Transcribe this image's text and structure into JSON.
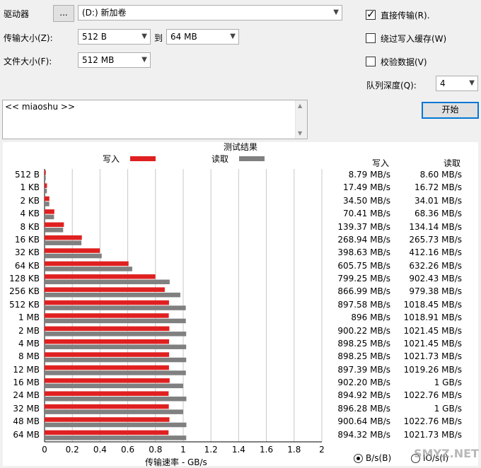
{
  "drive": {
    "label": "驱动器",
    "browse_label": "...",
    "value": "(D:) 新加卷"
  },
  "transfer_size": {
    "label": "传输大小(Z):",
    "from": "512 B",
    "to_label": "到",
    "to": "64 MB"
  },
  "file_size": {
    "label": "文件大小(F):",
    "value": "512 MB"
  },
  "options": {
    "direct_io": {
      "label": "直接传输(R).",
      "checked": true
    },
    "bypass_write_cache": {
      "label": "绕过写入缓存(W)",
      "checked": false
    },
    "verify_data": {
      "label": "校验数据(V)",
      "checked": false
    }
  },
  "queue_depth": {
    "label": "队列深度(Q):",
    "value": "4"
  },
  "description": {
    "value": "<< miaoshu >>"
  },
  "start_button": {
    "label": "开始"
  },
  "results": {
    "title": "测试结果",
    "legend_write": "写入",
    "legend_read": "读取",
    "col_write": "写入",
    "col_read": "读取",
    "xlabel": "传输速率 - GB/s",
    "rows": [
      {
        "size": "512 B",
        "write": "8.79 MB/s",
        "read": "8.60 MB/s"
      },
      {
        "size": "1 KB",
        "write": "17.49 MB/s",
        "read": "16.72 MB/s"
      },
      {
        "size": "2 KB",
        "write": "34.50 MB/s",
        "read": "34.01 MB/s"
      },
      {
        "size": "4 KB",
        "write": "70.41 MB/s",
        "read": "68.36 MB/s"
      },
      {
        "size": "8 KB",
        "write": "139.37 MB/s",
        "read": "134.14 MB/s"
      },
      {
        "size": "16 KB",
        "write": "268.94 MB/s",
        "read": "265.73 MB/s"
      },
      {
        "size": "32 KB",
        "write": "398.63 MB/s",
        "read": "412.16 MB/s"
      },
      {
        "size": "64 KB",
        "write": "605.75 MB/s",
        "read": "632.26 MB/s"
      },
      {
        "size": "128 KB",
        "write": "799.25 MB/s",
        "read": "902.43 MB/s"
      },
      {
        "size": "256 KB",
        "write": "866.99 MB/s",
        "read": "979.38 MB/s"
      },
      {
        "size": "512 KB",
        "write": "897.58 MB/s",
        "read": "1018.45 MB/s"
      },
      {
        "size": "1 MB",
        "write": "896 MB/s",
        "read": "1018.91 MB/s"
      },
      {
        "size": "2 MB",
        "write": "900.22 MB/s",
        "read": "1021.45 MB/s"
      },
      {
        "size": "4 MB",
        "write": "898.25 MB/s",
        "read": "1021.45 MB/s"
      },
      {
        "size": "8 MB",
        "write": "898.25 MB/s",
        "read": "1021.73 MB/s"
      },
      {
        "size": "12 MB",
        "write": "897.39 MB/s",
        "read": "1019.26 MB/s"
      },
      {
        "size": "16 MB",
        "write": "902.20 MB/s",
        "read": "1 GB/s"
      },
      {
        "size": "24 MB",
        "write": "894.92 MB/s",
        "read": "1022.76 MB/s"
      },
      {
        "size": "32 MB",
        "write": "896.28 MB/s",
        "read": "1 GB/s"
      },
      {
        "size": "48 MB",
        "write": "900.64 MB/s",
        "read": "1022.76 MB/s"
      },
      {
        "size": "64 MB",
        "write": "894.32 MB/s",
        "read": "1021.73 MB/s"
      }
    ],
    "units": {
      "bytes_label": "B/s(B)",
      "io_label": "IO/s(I)",
      "selected": "bytes"
    }
  },
  "watermark": "SMYZ.NET",
  "chart_data": {
    "type": "bar",
    "orientation": "horizontal",
    "categories": [
      "512 B",
      "1 KB",
      "2 KB",
      "4 KB",
      "8 KB",
      "16 KB",
      "32 KB",
      "64 KB",
      "128 KB",
      "256 KB",
      "512 KB",
      "1 MB",
      "2 MB",
      "4 MB",
      "8 MB",
      "12 MB",
      "16 MB",
      "24 MB",
      "32 MB",
      "48 MB",
      "64 MB"
    ],
    "series": [
      {
        "name": "写入",
        "color": "#e02020",
        "values": [
          0.00879,
          0.01749,
          0.0345,
          0.07041,
          0.13937,
          0.26894,
          0.39863,
          0.60575,
          0.79925,
          0.86699,
          0.89758,
          0.896,
          0.90022,
          0.89825,
          0.89825,
          0.89739,
          0.9022,
          0.89492,
          0.89628,
          0.90064,
          0.89432
        ]
      },
      {
        "name": "读取",
        "color": "#808080",
        "values": [
          0.0086,
          0.01672,
          0.03401,
          0.06836,
          0.13414,
          0.26573,
          0.41216,
          0.63226,
          0.90243,
          0.97938,
          1.01845,
          1.01891,
          1.02145,
          1.02145,
          1.02173,
          1.01926,
          1.0,
          1.02276,
          1.0,
          1.02276,
          1.02173
        ]
      }
    ],
    "xlabel": "传输速率 - GB/s",
    "xlim": [
      0,
      2
    ],
    "xticks": [
      "0",
      "0.2",
      "0.4",
      "0.6",
      "0.8",
      "1",
      "1.2",
      "1.4",
      "1.6",
      "1.8",
      "2"
    ],
    "grid": true,
    "legend": "top"
  }
}
